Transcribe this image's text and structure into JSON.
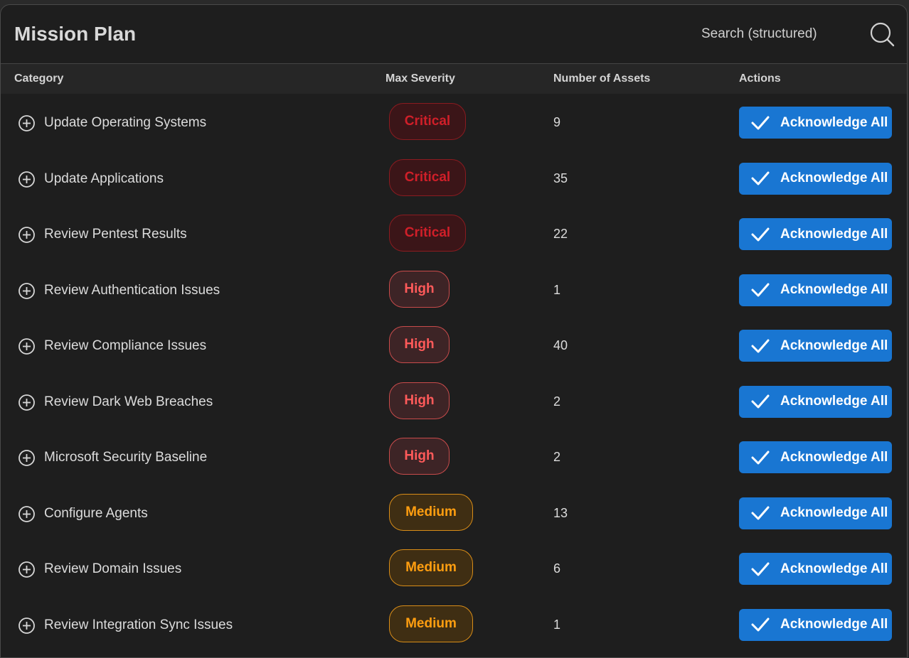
{
  "header": {
    "title": "Mission Plan",
    "search_label": "Search (structured)",
    "search_icon": "search-icon"
  },
  "columns": {
    "category": "Category",
    "max_severity": "Max Severity",
    "number_of_assets": "Number of Assets",
    "actions": "Actions"
  },
  "colors": {
    "panel_bg": "#1e1e1e",
    "accent_blue": "#1976d2",
    "critical": "#d01f29",
    "high": "#ff5a5a",
    "medium": "#ff9e10"
  },
  "rows": [
    {
      "category": "Update Operating Systems",
      "severity": "Critical",
      "severity_level": "critical",
      "assets": "9",
      "action_label": "Acknowledge All"
    },
    {
      "category": "Update Applications",
      "severity": "Critical",
      "severity_level": "critical",
      "assets": "35",
      "action_label": "Acknowledge All"
    },
    {
      "category": "Review Pentest Results",
      "severity": "Critical",
      "severity_level": "critical",
      "assets": "22",
      "action_label": "Acknowledge All"
    },
    {
      "category": "Review Authentication Issues",
      "severity": "High",
      "severity_level": "high",
      "assets": "1",
      "action_label": "Acknowledge All"
    },
    {
      "category": "Review Compliance Issues",
      "severity": "High",
      "severity_level": "high",
      "assets": "40",
      "action_label": "Acknowledge All"
    },
    {
      "category": "Review Dark Web Breaches",
      "severity": "High",
      "severity_level": "high",
      "assets": "2",
      "action_label": "Acknowledge All"
    },
    {
      "category": "Microsoft Security Baseline",
      "severity": "High",
      "severity_level": "high",
      "assets": "2",
      "action_label": "Acknowledge All"
    },
    {
      "category": "Configure Agents",
      "severity": "Medium",
      "severity_level": "medium",
      "assets": "13",
      "action_label": "Acknowledge All"
    },
    {
      "category": "Review Domain Issues",
      "severity": "Medium",
      "severity_level": "medium",
      "assets": "6",
      "action_label": "Acknowledge All"
    },
    {
      "category": "Review Integration Sync Issues",
      "severity": "Medium",
      "severity_level": "medium",
      "assets": "1",
      "action_label": "Acknowledge All"
    }
  ]
}
